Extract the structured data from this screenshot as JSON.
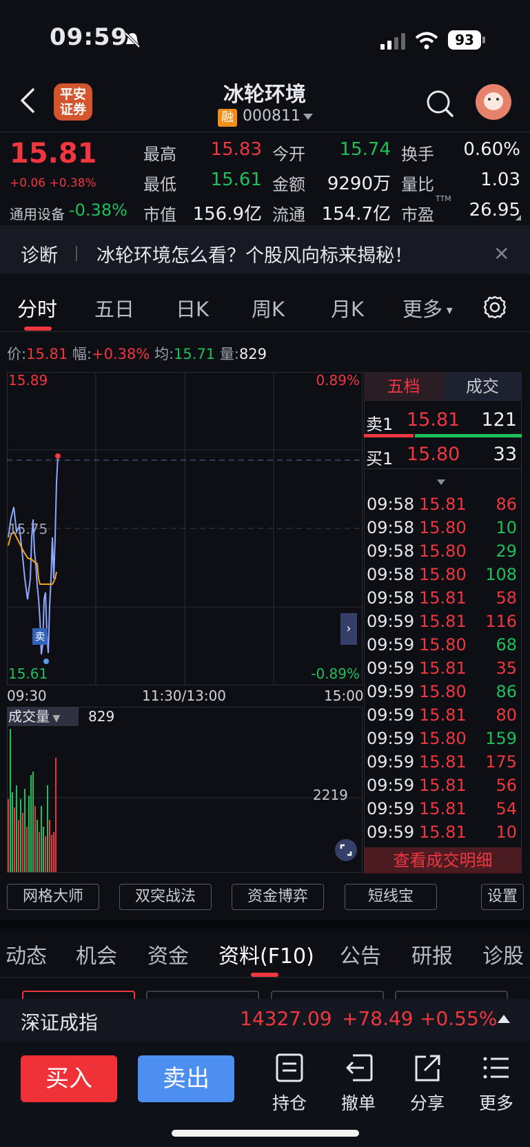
{
  "status_bar": {
    "time": "09:59",
    "battery": "93"
  },
  "header": {
    "broker_logo": "平安\n证券",
    "title": "冰轮环境",
    "margin_badge": "融",
    "code": "000811"
  },
  "quote": {
    "price": "15.81",
    "change": "+0.06 +0.38%",
    "sector_name": "通用设备",
    "sector_pct": "-0.38%",
    "high_label": "最高",
    "high": "15.83",
    "open_label": "今开",
    "open": "15.74",
    "turnover_label": "换手",
    "turnover": "0.60%",
    "low_label": "最低",
    "low": "15.61",
    "amount_label": "金额",
    "amount": "9290万",
    "volratio_label": "量比",
    "volratio": "1.03",
    "mcap_label": "市值",
    "mcap": "156.9亿",
    "float_label": "流通",
    "float": "154.7亿",
    "pe_label": "市盈",
    "pe_sup": "TTM",
    "pe": "26.95"
  },
  "diagnosis": {
    "label": "诊断",
    "text": "冰轮环境怎么看？个股风向标来揭秘！"
  },
  "period_tabs": [
    "分时",
    "五日",
    "日K",
    "周K",
    "月K",
    "更多"
  ],
  "info_line": {
    "price_label": "价:",
    "price": "15.81",
    "amp_label": "幅:",
    "amp": "+0.38%",
    "avg_label": "均:",
    "avg": "15.71",
    "vol_label": "量:",
    "vol": "829"
  },
  "chart": {
    "top_price": "15.89",
    "top_pct": "0.89%",
    "mid_price": "15.75",
    "bottom_price": "15.61",
    "bottom_pct": "-0.89%",
    "time_start": "09:30",
    "time_mid": "11:30/13:00",
    "time_end": "15:00",
    "sell_marker": "卖",
    "volume_label": "成交量",
    "volume_value": "829",
    "volume_axis": "2219",
    "colors": {
      "price_line": "#8fa8ff",
      "avg_line": "#f2a51a",
      "up": "#f0373f",
      "down": "#1fbf5a"
    }
  },
  "order_book": {
    "tab_five": "五档",
    "tab_trades": "成交",
    "ask_label": "卖1",
    "ask_price": "15.81",
    "ask_vol": "121",
    "bid_label": "买1",
    "bid_price": "15.80",
    "bid_vol": "33",
    "trades": [
      {
        "t": "09:58",
        "p": "15.81",
        "v": "86",
        "pc": "red",
        "vc": "red"
      },
      {
        "t": "09:58",
        "p": "15.80",
        "v": "10",
        "pc": "red",
        "vc": "green"
      },
      {
        "t": "09:58",
        "p": "15.80",
        "v": "29",
        "pc": "red",
        "vc": "green"
      },
      {
        "t": "09:58",
        "p": "15.80",
        "v": "108",
        "pc": "red",
        "vc": "green"
      },
      {
        "t": "09:58",
        "p": "15.81",
        "v": "58",
        "pc": "red",
        "vc": "red"
      },
      {
        "t": "09:59",
        "p": "15.81",
        "v": "116",
        "pc": "red",
        "vc": "red"
      },
      {
        "t": "09:59",
        "p": "15.80",
        "v": "68",
        "pc": "red",
        "vc": "green"
      },
      {
        "t": "09:59",
        "p": "15.81",
        "v": "35",
        "pc": "red",
        "vc": "red"
      },
      {
        "t": "09:59",
        "p": "15.80",
        "v": "86",
        "pc": "red",
        "vc": "green"
      },
      {
        "t": "09:59",
        "p": "15.81",
        "v": "80",
        "pc": "red",
        "vc": "red"
      },
      {
        "t": "09:59",
        "p": "15.80",
        "v": "159",
        "pc": "red",
        "vc": "green"
      },
      {
        "t": "09:59",
        "p": "15.81",
        "v": "175",
        "pc": "red",
        "vc": "red"
      },
      {
        "t": "09:59",
        "p": "15.81",
        "v": "56",
        "pc": "red",
        "vc": "red"
      },
      {
        "t": "09:59",
        "p": "15.81",
        "v": "54",
        "pc": "red",
        "vc": "red"
      },
      {
        "t": "09:59",
        "p": "15.81",
        "v": "10",
        "pc": "red",
        "vc": "red"
      }
    ],
    "detail_link": "查看成交明细"
  },
  "tools": [
    "网格大师",
    "双突战法",
    "资金博弈",
    "短线宝",
    "设置"
  ],
  "lower_tabs": [
    "动态",
    "机会",
    "资金",
    "资料(F10)",
    "公告",
    "研报",
    "诊股"
  ],
  "index_bar": {
    "name": "深证成指",
    "value": "14327.09",
    "change": "+78.49",
    "pct": "+0.55%"
  },
  "bottom_bar": {
    "buy": "买入",
    "sell": "卖出",
    "hold": "持仓",
    "cancel": "撤单",
    "share": "分享",
    "more": "更多"
  }
}
